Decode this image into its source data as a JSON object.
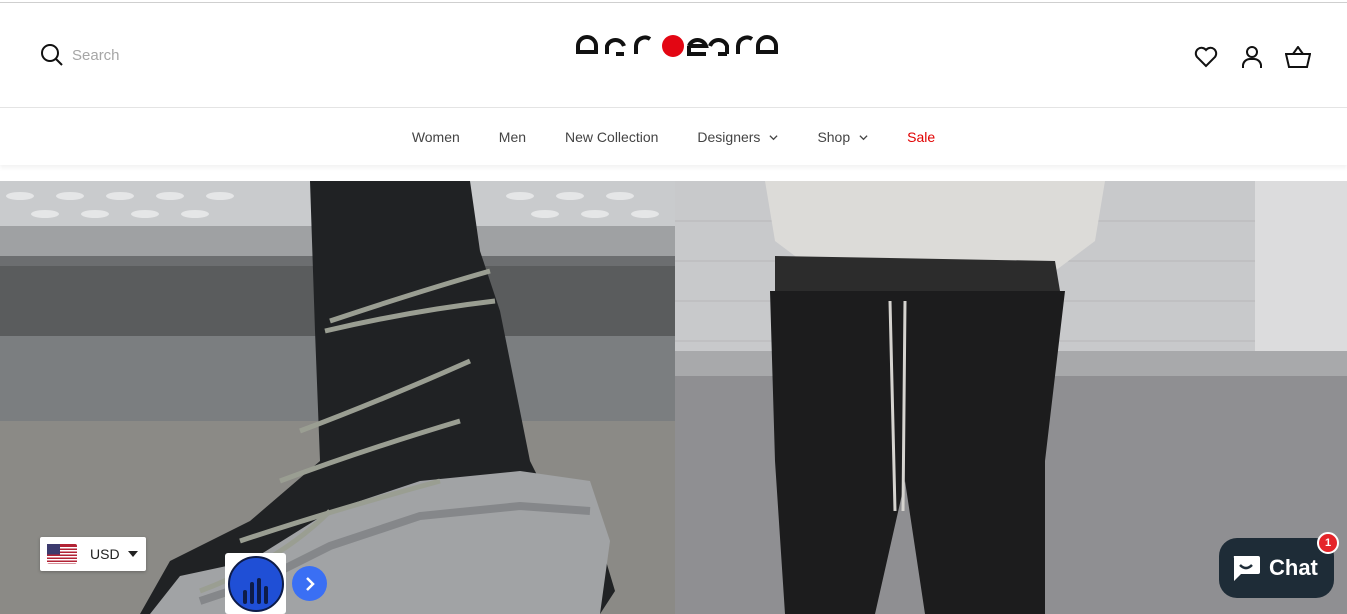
{
  "header": {
    "search_placeholder": "Search",
    "logo_alt": "acrocra",
    "icons": [
      "search-icon",
      "heart-icon",
      "account-icon",
      "basket-icon"
    ]
  },
  "nav": {
    "items": [
      {
        "label": "Women",
        "has_dropdown": false
      },
      {
        "label": "Men",
        "has_dropdown": false
      },
      {
        "label": "New Collection",
        "has_dropdown": false
      },
      {
        "label": "Designers",
        "has_dropdown": true
      },
      {
        "label": "Shop",
        "has_dropdown": true
      },
      {
        "label": "Sale",
        "has_dropdown": false
      }
    ]
  },
  "currency": {
    "selected": "USD",
    "flag": "us-flag-icon"
  },
  "chat": {
    "label": "Chat",
    "badge": "1"
  },
  "colors": {
    "sale": "#e10000",
    "logo_dot": "#e30613",
    "chat_bg": "#1e2c37",
    "chat_badge": "#e5252a",
    "widget_blue": "#1f4fd6"
  }
}
